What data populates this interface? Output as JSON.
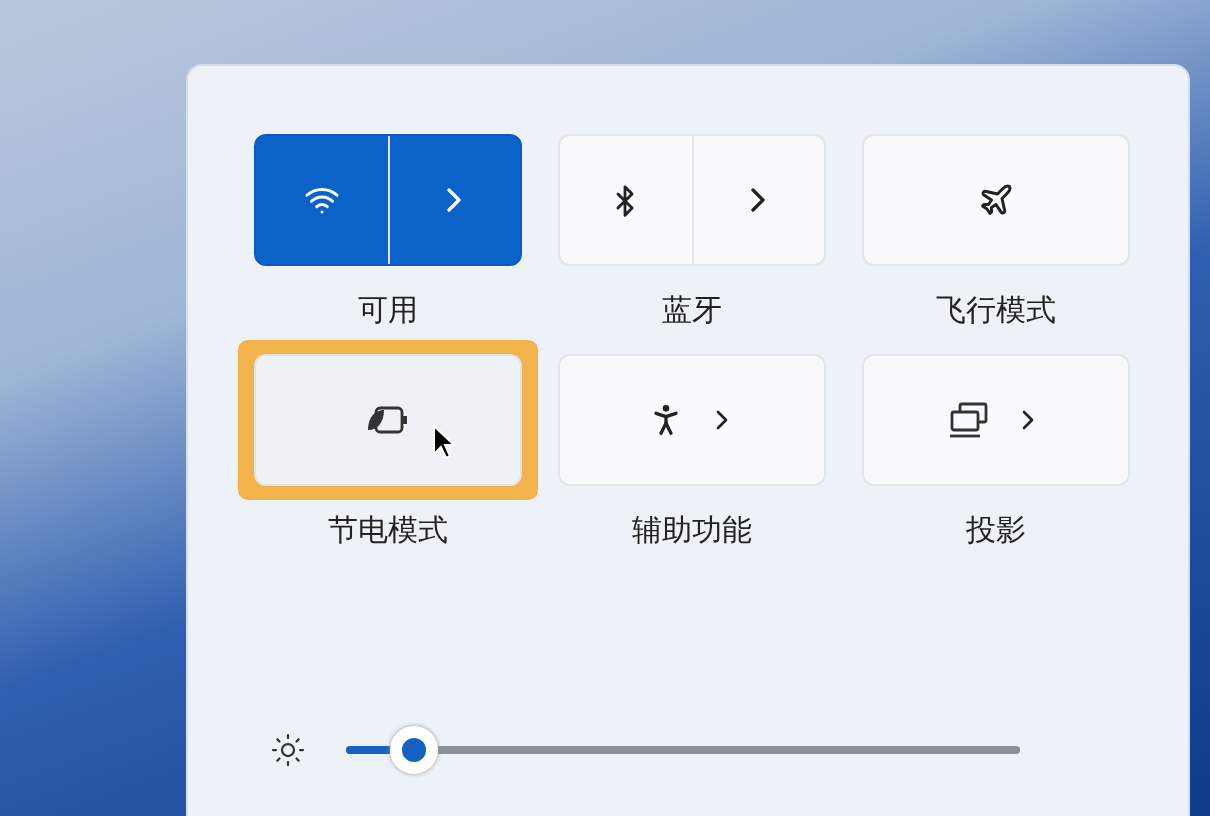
{
  "tiles": [
    {
      "label": "可用",
      "kind": "split",
      "on": true,
      "focused": false
    },
    {
      "label": "蓝牙",
      "kind": "split",
      "on": false,
      "focused": false
    },
    {
      "label": "飞行模式",
      "kind": "plain",
      "on": false,
      "focused": false
    },
    {
      "label": "节电模式",
      "kind": "plain",
      "on": false,
      "focused": true
    },
    {
      "label": "辅助功能",
      "kind": "chevron",
      "on": false,
      "focused": false
    },
    {
      "label": "投影",
      "kind": "chevron",
      "on": false,
      "focused": false
    }
  ],
  "brightness": {
    "level": 0.1
  }
}
